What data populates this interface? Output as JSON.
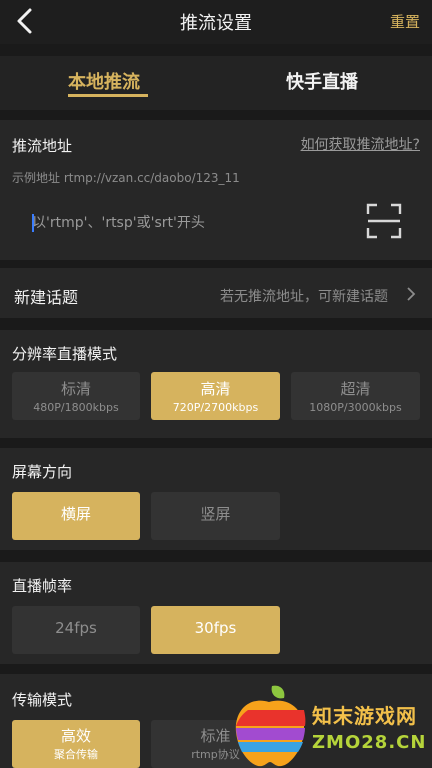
{
  "header": {
    "title": "推流设置",
    "reset_label": "重置"
  },
  "tabs": [
    {
      "label": "本地推流",
      "active": true
    },
    {
      "label": "快手直播",
      "active": false
    }
  ],
  "push_url": {
    "section_title": "推流地址",
    "help_link": "如何获取推流地址?",
    "example": "示例地址 rtmp://vzan.cc/daobo/123_11",
    "placeholder": "以'rtmp'、'rtsp'或'srt'开头",
    "value": ""
  },
  "new_topic": {
    "label": "新建话题",
    "hint": "若无推流地址，可新建话题"
  },
  "resolution": {
    "section_title": "分辨率直播模式",
    "options": [
      {
        "label": "标清",
        "detail": "480P/1800kbps",
        "selected": false
      },
      {
        "label": "高清",
        "detail": "720P/2700kbps",
        "selected": true
      },
      {
        "label": "超清",
        "detail": "1080P/3000kbps",
        "selected": false
      }
    ]
  },
  "orientation": {
    "section_title": "屏幕方向",
    "options": [
      {
        "label": "横屏",
        "selected": true
      },
      {
        "label": "竖屏",
        "selected": false
      }
    ]
  },
  "frame_rate": {
    "section_title": "直播帧率",
    "options": [
      {
        "label": "24fps",
        "selected": false
      },
      {
        "label": "30fps",
        "selected": true
      }
    ]
  },
  "transport": {
    "section_title": "传输模式",
    "options": [
      {
        "label": "高效",
        "detail": "聚合传输",
        "selected": true
      },
      {
        "label": "标准",
        "detail": "rtmp协议",
        "selected": false
      }
    ]
  },
  "watermark": {
    "name": "知末游戏网",
    "domain": "ZMO28.CN"
  },
  "colors": {
    "accent": "#d6b35e",
    "background": "#1a1a1a",
    "panel": "#272727",
    "option": "#333333"
  }
}
